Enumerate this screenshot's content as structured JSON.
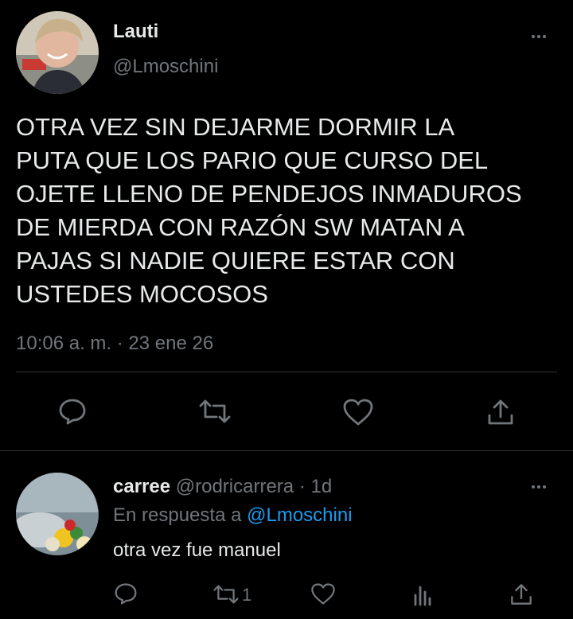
{
  "tweet": {
    "author_name": "Lauti",
    "handle": "@Lmoschini",
    "text_lines": [
      "OTRA VEZ SIN DEJARME DORMIR LA",
      "PUTA QUE LOS PARIO QUE CURSO DEL",
      "OJETE LLENO DE PENDEJOS INMADUROS",
      "DE MIERDA CON RAZÓN SW MATAN A",
      "PAJAS SI NADIE QUIERE ESTAR CON",
      "USTEDES MOCOSOS"
    ],
    "timestamp": "10:06 a. m. · 23 ene 26"
  },
  "reply": {
    "author_name": "carree",
    "handle_time": "@rodricarrera · 1d",
    "replying_prefix": "En respuesta a",
    "replying_handle": "@Lmoschini",
    "text": "otra vez fue manuel",
    "retweet_count": "1"
  },
  "icons": {
    "reply": "speech-bubble-icon",
    "retweet": "retweet-arrows-icon",
    "like": "heart-icon",
    "share": "share-upload-icon",
    "views": "bar-chart-icon",
    "more": "ellipsis-icon"
  },
  "colors": {
    "background": "#000000",
    "text": "#e7e9ea",
    "muted": "#71767b",
    "accent": "#1d9bf0"
  }
}
